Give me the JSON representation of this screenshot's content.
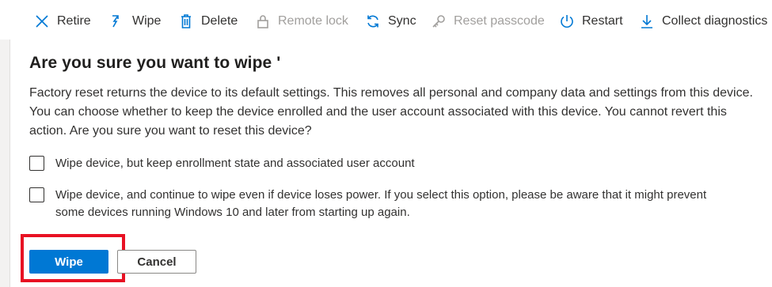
{
  "toolbar": {
    "items": [
      {
        "label": "Retire",
        "icon": "close-icon",
        "enabled": true
      },
      {
        "label": "Wipe",
        "icon": "wipe-icon",
        "enabled": true
      },
      {
        "label": "Delete",
        "icon": "trash-icon",
        "enabled": true
      },
      {
        "label": "Remote lock",
        "icon": "lock-icon",
        "enabled": false
      },
      {
        "label": "Sync",
        "icon": "sync-icon",
        "enabled": true
      },
      {
        "label": "Reset passcode",
        "icon": "key-icon",
        "enabled": false
      },
      {
        "label": "Restart",
        "icon": "power-icon",
        "enabled": true
      },
      {
        "label": "Collect diagnostics",
        "icon": "download-icon",
        "enabled": true
      }
    ]
  },
  "dialog": {
    "title": "Are you sure you want to wipe '",
    "body": "Factory reset returns the device to its default settings. This removes all personal and company data and settings from this device. You can choose whether to keep the device enrolled and the user account associated with this device. You cannot revert this action. Are you sure you want to reset this device?",
    "options": [
      {
        "label": "Wipe device, but keep enrollment state and associated user account",
        "checked": false
      },
      {
        "label": "Wipe device, and continue to wipe even if device loses power. If you select this option, please be aware that it might prevent some devices running Windows 10 and later from starting up again.",
        "checked": false
      }
    ],
    "primary_button": "Wipe",
    "secondary_button": "Cancel"
  },
  "colors": {
    "accent": "#0078d4",
    "highlight": "#e81123",
    "disabled": "#a19f9d"
  }
}
